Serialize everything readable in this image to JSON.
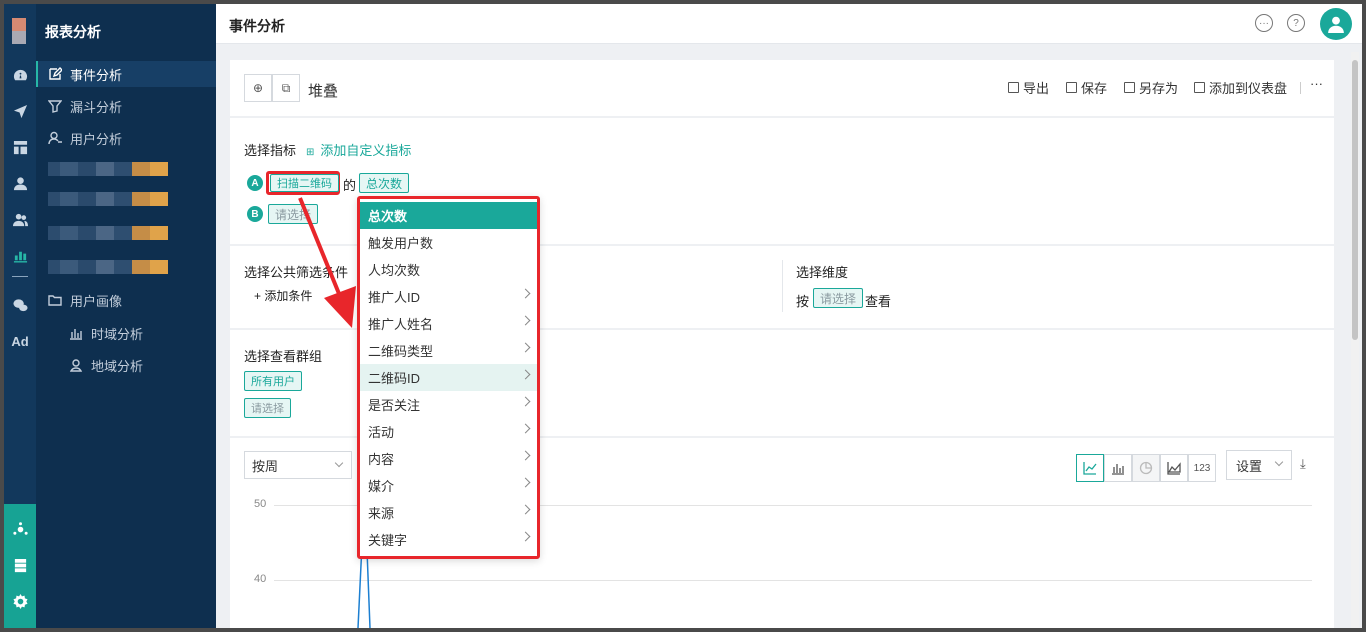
{
  "sidebar": {
    "title": "报表分析",
    "items": [
      {
        "label": "事件分析",
        "active": true
      },
      {
        "label": "漏斗分析"
      },
      {
        "label": "用户分析"
      },
      {
        "label": "用户画像"
      },
      {
        "label": "时域分析"
      },
      {
        "label": "地域分析"
      }
    ]
  },
  "rail": {
    "ad_label": "Ad"
  },
  "header": {
    "title": "事件分析"
  },
  "toolbar": {
    "mode_label": "堆叠",
    "actions": {
      "export": "导出",
      "save": "保存",
      "save_as": "另存为",
      "add_dashboard": "添加到仪表盘"
    },
    "more": "···"
  },
  "metrics": {
    "section_label": "选择指标",
    "add_custom": "添加自定义指标",
    "rows": [
      {
        "badge": "A",
        "event": "扫描二维码",
        "connector": "的",
        "measure": "总次数"
      },
      {
        "badge": "B",
        "placeholder": "请选择"
      }
    ]
  },
  "dropdown": {
    "items": [
      {
        "label": "总次数",
        "selected": true
      },
      {
        "label": "触发用户数"
      },
      {
        "label": "人均次数"
      },
      {
        "label": "推广人ID",
        "has_children": true
      },
      {
        "label": "推广人姓名",
        "has_children": true
      },
      {
        "label": "二维码类型",
        "has_children": true
      },
      {
        "label": "二维码ID",
        "has_children": true,
        "hover": true
      },
      {
        "label": "是否关注",
        "has_children": true
      },
      {
        "label": "活动",
        "has_children": true
      },
      {
        "label": "内容",
        "has_children": true
      },
      {
        "label": "媒介",
        "has_children": true
      },
      {
        "label": "来源",
        "has_children": true
      },
      {
        "label": "关键字",
        "has_children": true
      }
    ]
  },
  "filters": {
    "section_label": "选择公共筛选条件",
    "add_condition": "+ 添加条件",
    "dimension_label": "选择维度",
    "by": "按",
    "dimension_placeholder": "请选择",
    "view": "查看"
  },
  "groups": {
    "section_label": "选择查看群组",
    "selected": "所有用户",
    "placeholder": "请选择"
  },
  "chart_controls": {
    "period": "按周",
    "types": [
      "line-chart-icon",
      "bar-chart-icon",
      "pie-chart-icon",
      "area-chart-icon",
      "123"
    ],
    "settings": "设置"
  },
  "chart_data": {
    "type": "line",
    "y_ticks": [
      "50",
      "40"
    ],
    "accent": "#1c7fd1"
  },
  "colors": {
    "accent": "#1aa89a",
    "highlight": "#e8262b",
    "sidebar": "#0e2f4f"
  }
}
